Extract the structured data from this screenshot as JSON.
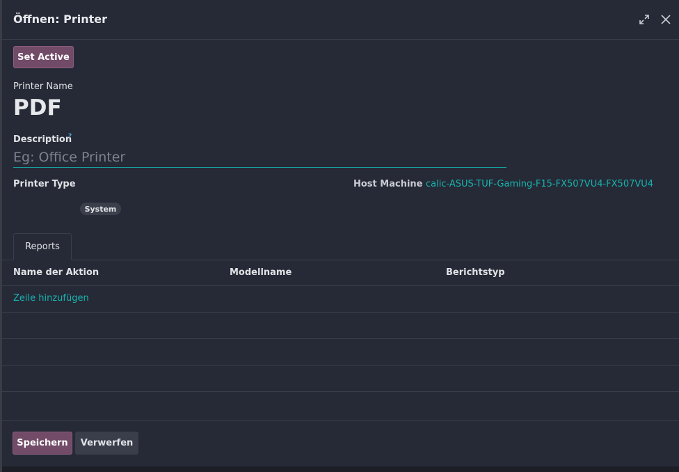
{
  "dialog": {
    "title": "Öffnen: Printer",
    "expand_icon": "expand-icon",
    "close_icon": "close-icon"
  },
  "actions": {
    "set_active_label": "Set Active"
  },
  "form": {
    "printer_name_label": "Printer Name",
    "printer_name_value": "PDF",
    "description_label": "Description",
    "description_help": "?",
    "description_placeholder": "Eg: Office Printer",
    "description_value": "",
    "printer_type_label": "Printer Type",
    "printer_type_badge": "System",
    "host_machine_label": "Host Machine",
    "host_machine_value": "calic-ASUS-TUF-Gaming-F15-FX507VU4-FX507VU4"
  },
  "tabs": [
    {
      "label": "Reports",
      "active": true
    }
  ],
  "table": {
    "columns": [
      "Name der Aktion",
      "Modellname",
      "Berichtstyp"
    ],
    "add_line_label": "Zeile hinzufügen",
    "rows": []
  },
  "footer": {
    "save_label": "Speichern",
    "discard_label": "Verwerfen"
  },
  "colors": {
    "accent": "#714b67",
    "link": "#17b4b0",
    "background": "#262a36"
  }
}
